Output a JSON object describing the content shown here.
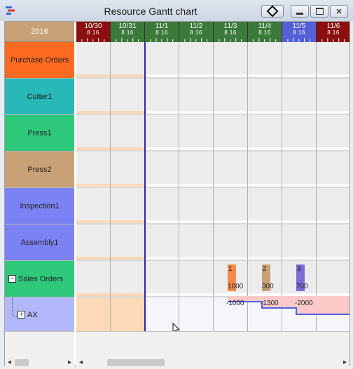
{
  "window": {
    "title": "Resource Gantt chart",
    "buttons": [
      {
        "name": "pin-button",
        "icon": "diamond-icon"
      },
      {
        "name": "minimize-button",
        "icon": "minimize-icon"
      },
      {
        "name": "maximize-button",
        "icon": "maximize-icon"
      },
      {
        "name": "close-button",
        "icon": "close-icon"
      }
    ]
  },
  "year_label": "2016",
  "resources": [
    {
      "label": "Purchase Orders",
      "color": "#ff6a21"
    },
    {
      "label": "Cutter1",
      "color": "#28b8b8"
    },
    {
      "label": "Press1",
      "color": "#2ec87a"
    },
    {
      "label": "Press2",
      "color": "#c8a176"
    },
    {
      "label": "Inspection1",
      "color": "#7b83f4"
    },
    {
      "label": "Assembly1",
      "color": "#7b83f4"
    },
    {
      "label": "Sales Orders",
      "color": "#2ec87a",
      "expander": "−"
    },
    {
      "label": "AX",
      "color": "#b2b8fb",
      "expander": "+"
    }
  ],
  "dates": [
    {
      "date": "10/30",
      "hours": "8 16",
      "color": "#8b0f0f"
    },
    {
      "date": "10/31",
      "hours": "8 16",
      "color": "#3b7a3b"
    },
    {
      "date": "11/1",
      "hours": "8 16",
      "color": "#3b7a3b"
    },
    {
      "date": "11/2",
      "hours": "8 16",
      "color": "#3b7a3b"
    },
    {
      "date": "11/3",
      "hours": "8 16",
      "color": "#3b7a3b"
    },
    {
      "date": "11/4",
      "hours": "8 16",
      "color": "#3b7a3b"
    },
    {
      "date": "11/5",
      "hours": "8 16",
      "color": "#5560d6"
    },
    {
      "date": "11/6",
      "hours": "8 16",
      "color": "#8b0f0f"
    }
  ],
  "sales_orders": [
    {
      "id": "1",
      "qty": "1000",
      "color": "#f08a4b"
    },
    {
      "id": "2",
      "qty": "300",
      "color": "#c8a176"
    },
    {
      "id": "3",
      "qty": "700",
      "color": "#7b6cd6"
    }
  ],
  "inventory_labels": [
    "-1000",
    "-1300",
    "-2000"
  ],
  "colors": {
    "weekend_shade": "#fcd9b8",
    "current_time_line": "#2a2aa8",
    "inventory_line": "#5560e0",
    "inventory_fill": "#fcc9c9"
  }
}
